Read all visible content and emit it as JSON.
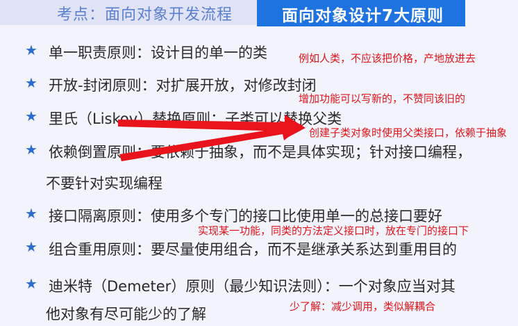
{
  "header": {
    "left_title": "考点：面向对象开发流程",
    "right_title": "面向对象设计7大原则"
  },
  "principles": [
    {
      "icon": "★",
      "text": "单一职责原则：设计目的单一的类"
    },
    {
      "icon": "★",
      "text": "开放-封闭原则：对扩展开放，对修改封闭"
    },
    {
      "icon": "★",
      "text": "里氏（Liskov）替换原则：子类可以替换父类"
    },
    {
      "icon": "★",
      "text": "依赖倒置原则：要依赖于抽象，而不是具体实现；针对接口编程，",
      "continuation": "不要针对实现编程"
    },
    {
      "icon": "★",
      "text": "接口隔离原则：使用多个专门的接口比使用单一的总接口要好"
    },
    {
      "icon": "★",
      "text": "组合重用原则：要尽量使用组合，而不是继承关系达到重用目的"
    },
    {
      "icon": "★",
      "text": "迪米特（Demeter）原则（最少知识法则）：一个对象应当对其",
      "continuation": "他对象有尽可能少的了解"
    }
  ],
  "annotations": [
    "例如人类，不应该把价格，产地放进去",
    "增加功能可以写新的，不赞同该旧的",
    "创建子类对象时使用父类接口，依赖于抽象",
    "实现某一功能，同类的方法定义接口时，放在专门的接口下",
    "少了解：减少调用，类似解耦合"
  ],
  "colors": {
    "accent": "#1f73e0",
    "annotation": "#e0141b",
    "star": "#2b6ccf"
  }
}
